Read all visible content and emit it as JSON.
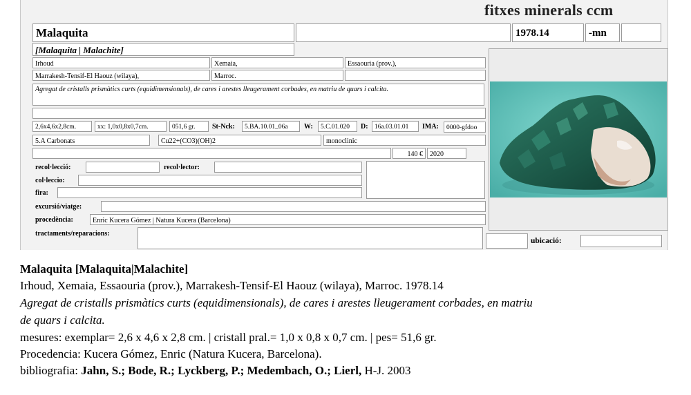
{
  "card": {
    "brand": "fitxes minerals ccm",
    "name": "Malaquita",
    "code": "1978.14",
    "suffix": "-mn",
    "synonyms": "[Malaquita | Malachite]",
    "locality1": "Irhoud",
    "locality2": "Xemaia,",
    "region": "Essaouria (prov.),",
    "province": "Marrakesh-Tensif-El Haouz (wilaya),",
    "country": "Marroc.",
    "description": "Agregat de cristalls prismàtics curts (equidimensionals), de cares i arestes lleugerament corbades, en matriu de quars i calcita.",
    "size": "2,6x4,6x2,8cm.",
    "crystal": "xx: 1,0x0,8x0,7cm.",
    "weight": "051,6 gr.",
    "stnck_label": "St-Nck:",
    "stnck": "5.BA.10.01_06a",
    "w_label": "W:",
    "w": "5.C.01.020",
    "d_label": "D:",
    "d": "16a.03.01.01",
    "ima_label": "IMA:",
    "ima": "0000-gfdoo",
    "class": "5.A Carbonats",
    "formula": "Cu22+(CO3)(OH)2",
    "system": "monoclinic",
    "price": "140 €",
    "year": "2020",
    "recoleccio_label": "recol·lecció:",
    "recolector_label": "recol·lector:",
    "colleccio_label": "col·leccio:",
    "fira_label": "fira:",
    "excursio_label": "excursió/viatge:",
    "procedencia_label": "procedència:",
    "procedencia": "Enric Kucera Gómez | Natura Kucera (Barcelona)",
    "tractaments_label": "tractaments/reparacions:",
    "ubicacio_label": "ubicació:"
  },
  "summary": {
    "title_name": "Malaquita",
    "title_syn": "[Malaquita|Malachite]",
    "locality_line": "Irhoud, Xemaia, Essaouria (prov.), Marrakesh-Tensif-El Haouz (wilaya), Marroc. 1978.14",
    "desc_line1": "Agregat de cristalls prismàtics curts (equidimensionals), de cares i arestes lleugerament corbades, en matriu",
    "desc_line2": "de quars i calcita.",
    "measures_line": "mesures: exemplar= 2,6 x 4,6 x 2,8 cm. | cristall pral.= 1,0 x 0,8 x 0,7 cm. | pes= 51,6 gr.",
    "procedencia_line": "Procedencia: Kucera Gómez, Enric (Natura Kucera, Barcelona).",
    "biblio_label": "bibliografia:",
    "biblio_authors": "Jahn, S.; Bode, R.; Lyckberg, P.; Medembach, O.; Lierl,",
    "biblio_rest": "H-J. 2003"
  },
  "colors": {
    "photo_bg": "#5cc3bc",
    "crystal": "#1f5a4a",
    "matrix": "#e8dcd0"
  }
}
